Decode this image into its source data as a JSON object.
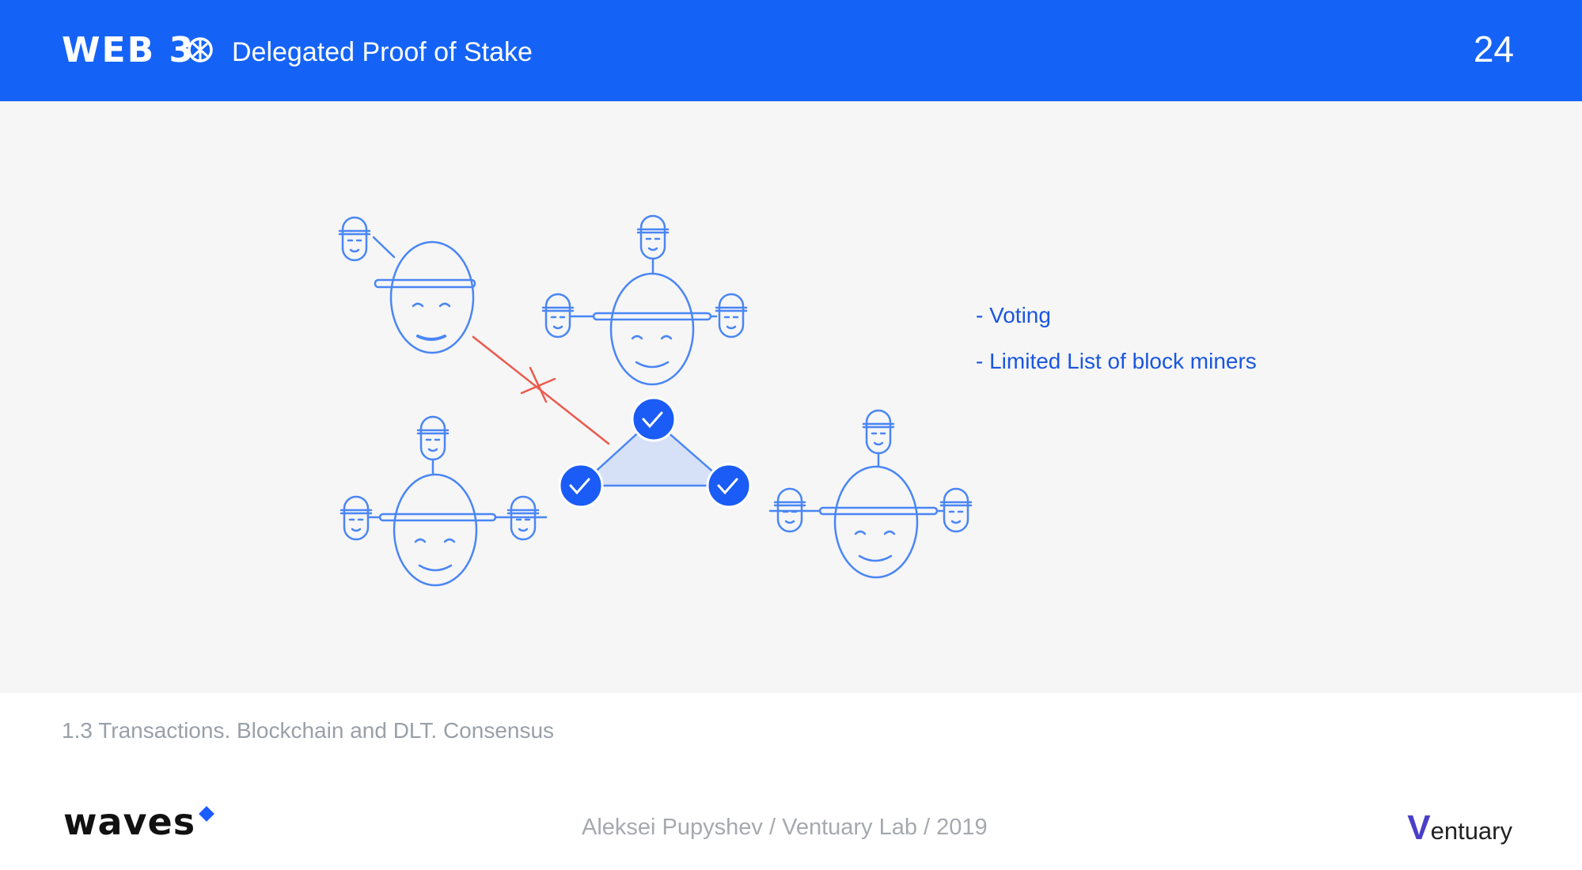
{
  "header": {
    "brand": "WEB 3",
    "brand_icon": "web3-logo-icon",
    "title": "Delegated Proof of Stake",
    "slide_number": "24",
    "background": "#1563F6"
  },
  "bullets": [
    "- Voting",
    "- Limited List of block miners"
  ],
  "footer": {
    "topic": "1.3  Transactions. Blockchain and DLT. Consensus",
    "waves_logo": "waves",
    "credit": "Aleksei Pupyshev / Ventuary Lab / 2019",
    "ventuary_v": "V",
    "ventuary_rest": "entuary"
  },
  "colors": {
    "accent": "#1563F6",
    "line_blue": "#4a86f5",
    "check_blue": "#1a5cf5",
    "triangle_fill": "#d6e1f7",
    "reject_red": "#ec5a4d",
    "bullet_text": "#1a56e0"
  }
}
